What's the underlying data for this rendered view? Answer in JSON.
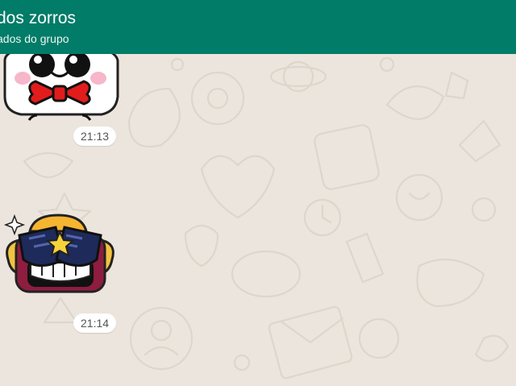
{
  "header": {
    "title": "dos zorros",
    "subtitle": "ados do grupo"
  },
  "messages": [
    {
      "type": "sticker",
      "sticker": "ghost-with-bow-tie",
      "time": "21:13"
    },
    {
      "type": "sticker",
      "sticker": "cool-brawler-with-sunglasses",
      "time": "21:14"
    }
  ],
  "colors": {
    "header": "#017C68",
    "wallpaper": "#ECE5DD",
    "bubble": "#FFFFFF"
  }
}
